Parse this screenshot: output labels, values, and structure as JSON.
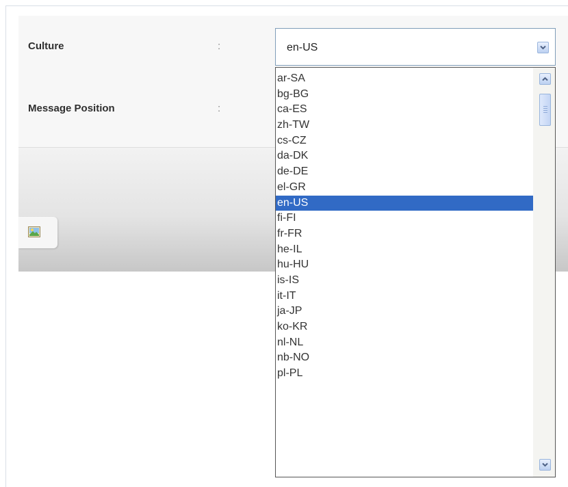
{
  "form": {
    "culture_label": "Culture",
    "message_position_label": "Message Position",
    "separator": ":"
  },
  "culture_select": {
    "value": "en-US",
    "options": [
      "ar-SA",
      "bg-BG",
      "ca-ES",
      "zh-TW",
      "cs-CZ",
      "da-DK",
      "de-DE",
      "el-GR",
      "en-US",
      "fi-FI",
      "fr-FR",
      "he-IL",
      "hu-HU",
      "is-IS",
      "it-IT",
      "ja-JP",
      "ko-KR",
      "nl-NL",
      "nb-NO",
      "pl-PL"
    ],
    "selected_index": 8
  },
  "icons": {
    "dropdown": "chevron-down-icon",
    "scroll_up": "chevron-up-icon",
    "scroll_down": "chevron-down-icon",
    "image_button": "image-icon"
  },
  "colors": {
    "selection": "#316ac5",
    "select_border": "#7f9db9"
  }
}
